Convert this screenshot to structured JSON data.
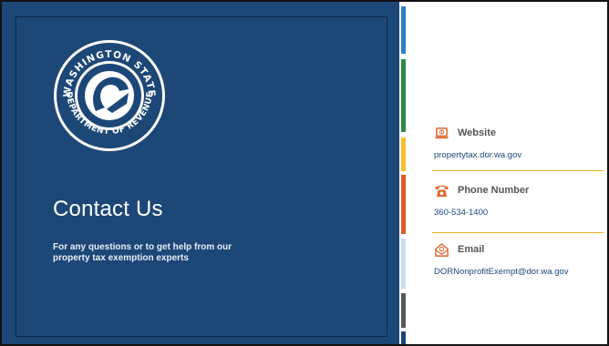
{
  "slide": {
    "title": "Contact Us",
    "subtitle": "For any questions or to get help from our property tax exemption experts"
  },
  "logo": {
    "top_text": "WASHINGTON STATE",
    "bottom_text": "DEPARTMENT OF REVENUE"
  },
  "contacts": [
    {
      "label": "Website",
      "value": "propertytax.dor.wa.gov",
      "icon": "laptop-icon"
    },
    {
      "label": "Phone Number",
      "value": "360-534-1400",
      "icon": "telephone-icon"
    },
    {
      "label": "Email",
      "value": "DORNonprofitExempt@dor.wa.gov",
      "icon": "envelope-icon"
    }
  ],
  "colors": {
    "panel_blue": "#1c4777",
    "accent_gold": "#f0b323",
    "icon_orange": "#e2652e",
    "link_blue": "#1c4777",
    "stripe_colors": [
      "#2e80c8",
      "#2c8a45",
      "#f6c02c",
      "#dc5a28",
      "#c7dcef",
      "#595959",
      "#1c4777"
    ]
  }
}
